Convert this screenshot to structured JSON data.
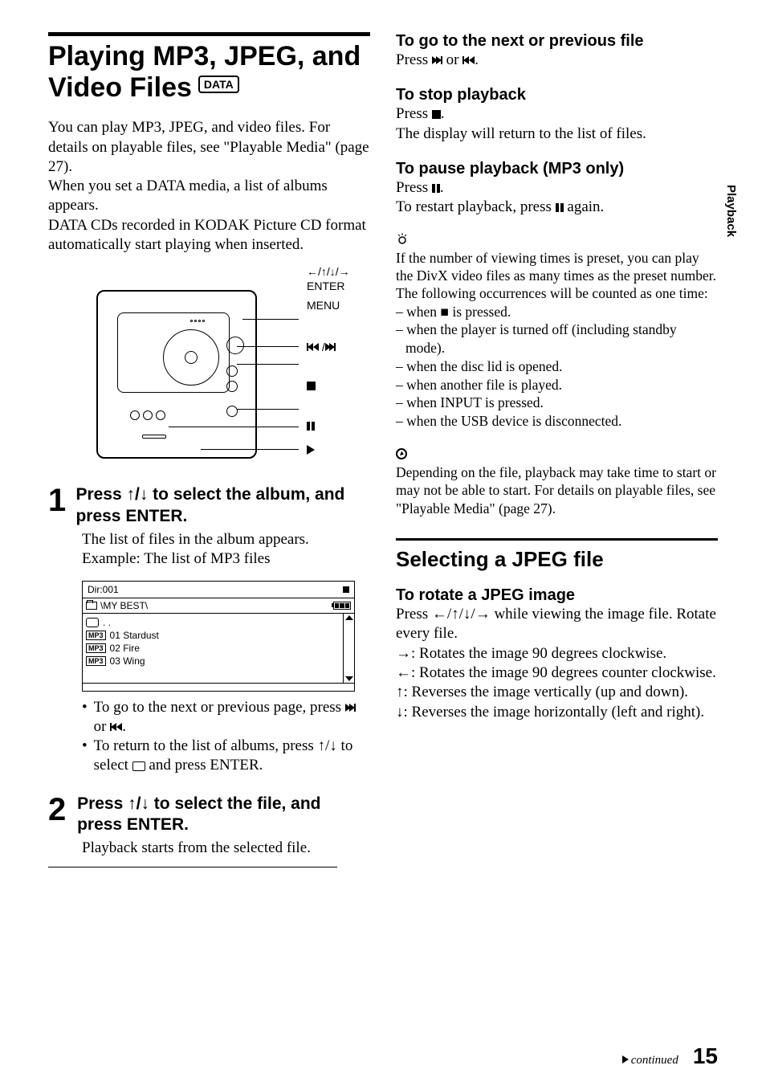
{
  "sideTab": "Playback",
  "pageNumber": "15",
  "continued": "continued",
  "left": {
    "title": "Playing MP3, JPEG, and Video Files",
    "badge": "DATA",
    "intro1": "You can play MP3, JPEG, and video files. For details on playable files, see \"Playable Media\" (page 27).",
    "intro2": "When you set a DATA media, a list of albums appears.",
    "intro3": "DATA CDs recorded in KODAK Picture CD format automatically start playing when inserted.",
    "illus": {
      "l1": "←/↑/↓/→",
      "l2": "ENTER",
      "l3": "MENU"
    },
    "steps": [
      {
        "num": "1",
        "heading": "Press ↑/↓ to select the album, and press ENTER.",
        "body": "The list of files in the album appears. Example: The list of MP3 files",
        "fb": {
          "dir": "Dir:001",
          "path": "\\MY BEST\\",
          "rows": [
            {
              "tag": "",
              "name": ". ."
            },
            {
              "tag": "MP3",
              "name": "01 Stardust"
            },
            {
              "tag": "MP3",
              "name": "02 Fire"
            },
            {
              "tag": "MP3",
              "name": "03 Wing"
            }
          ]
        },
        "bullets": [
          {
            "pre": "To go to the next or previous page, press ",
            "post": "."
          },
          {
            "pre": "To return to the list of albums, press ↑/↓ to select ",
            "post": " and press ENTER."
          }
        ]
      },
      {
        "num": "2",
        "heading": "Press ↑/↓ to select the file, and press ENTER.",
        "body": "Playback starts from the selected file."
      }
    ]
  },
  "right": {
    "s1": {
      "h": "To go to the next or previous file",
      "pre": "Press ",
      "mid": " or ",
      "post": "."
    },
    "s2": {
      "h": "To stop playback",
      "l1pre": "Press ",
      "l1post": ".",
      "l2": "The display will return to the list of files."
    },
    "s3": {
      "h": "To pause playback (MP3 only)",
      "l1pre": "Press ",
      "l1post": ".",
      "l2pre": "To restart playback, press ",
      "l2post": " again."
    },
    "tipIntro": "If the number of viewing times is preset, you can play the DivX video files as many times as the preset number. The following occurrences will be counted as one time:",
    "tips": [
      "– when ■ is pressed.",
      "– when the player is turned off (including standby mode).",
      "– when the disc lid is opened.",
      "– when another file is played.",
      "– when INPUT is pressed.",
      "– when the USB device is disconnected."
    ],
    "note": "Depending on the file, playback may take time to start or may not be able to start. For details on playable files, see \"Playable Media\" (page 27).",
    "subTitle": "Selecting a JPEG file",
    "rot": {
      "h": "To rotate a JPEG image",
      "l1": "Press ←/↑/↓/→ while viewing the image file. Rotate every file.",
      "r1": "→: Rotates the image 90 degrees clockwise.",
      "r2": "←: Rotates the image 90 degrees counter clockwise.",
      "r3": "↑: Reverses the image vertically (up and down).",
      "r4": "↓: Reverses the image horizontally (left and right)."
    }
  }
}
